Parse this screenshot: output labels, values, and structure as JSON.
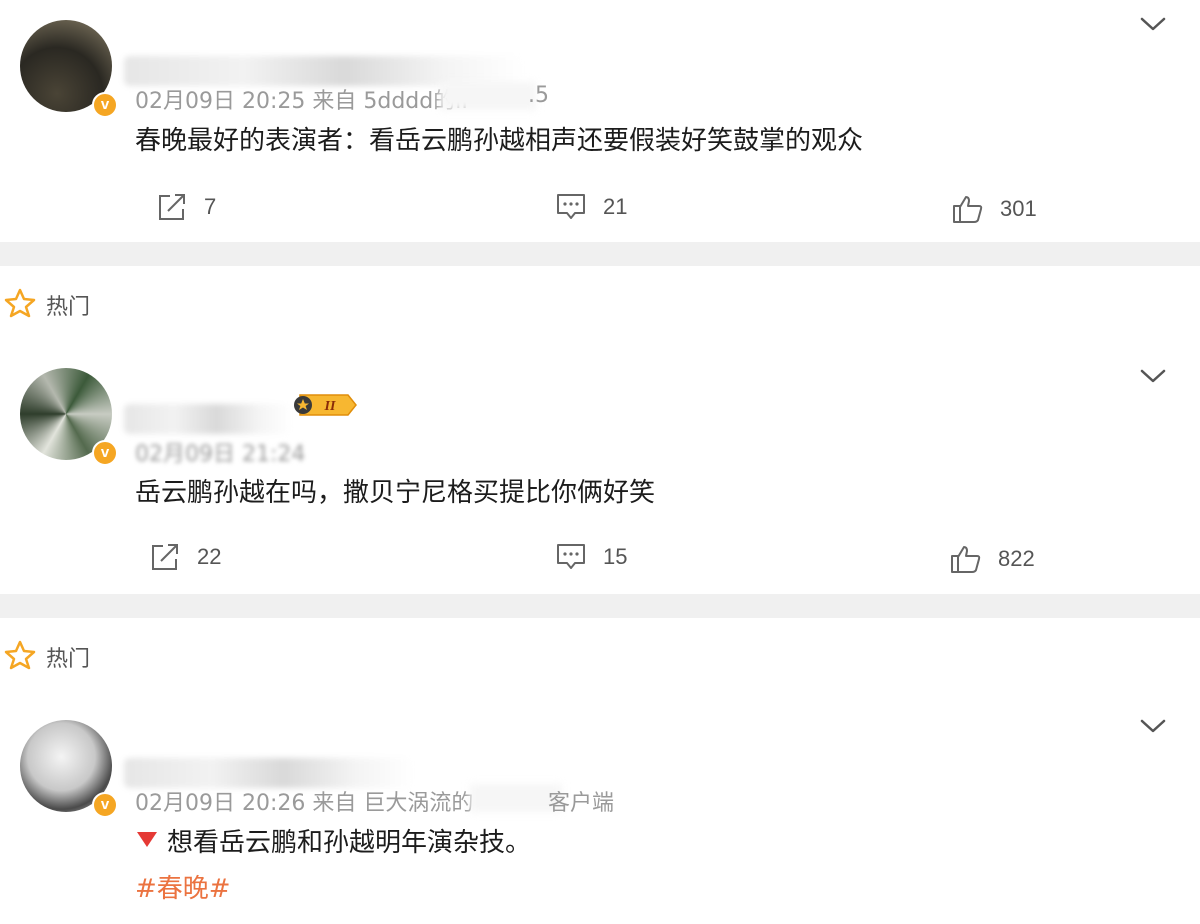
{
  "posts": [
    {
      "meta": "02月09日 20:25 来自 5dddd的iP",
      "meta_tail": ".5",
      "content": "春晚最好的表演者：看岳云鹏孙越相声还要假装好笑鼓掌的观众",
      "repost_count": "7",
      "comment_count": "21",
      "like_count": "301"
    },
    {
      "hot_label": "热门",
      "level": "II",
      "meta": "02月09日 21:24",
      "content": "岳云鹏孙越在吗，撒贝宁尼格买提比你俩好笑",
      "repost_count": "22",
      "comment_count": "15",
      "like_count": "822"
    },
    {
      "hot_label": "热门",
      "meta": "02月09日 20:26 来自 巨大涡流的",
      "meta_tail": "客户端",
      "content": "想看岳云鹏和孙越明年演杂技。",
      "hashtag": "#春晚#"
    }
  ],
  "icons": {
    "repost": "repost-icon",
    "comment": "comment-icon",
    "like": "thumbs-up-icon",
    "hot": "star-icon",
    "more": "chevron-down-icon",
    "verified": "verified-v-badge",
    "down_triangle": "red-down-triangle"
  },
  "colors": {
    "hashtag": "#eb7340",
    "verified": "#f5a623",
    "divider": "#f0f0f0",
    "star": "#f5a623"
  }
}
